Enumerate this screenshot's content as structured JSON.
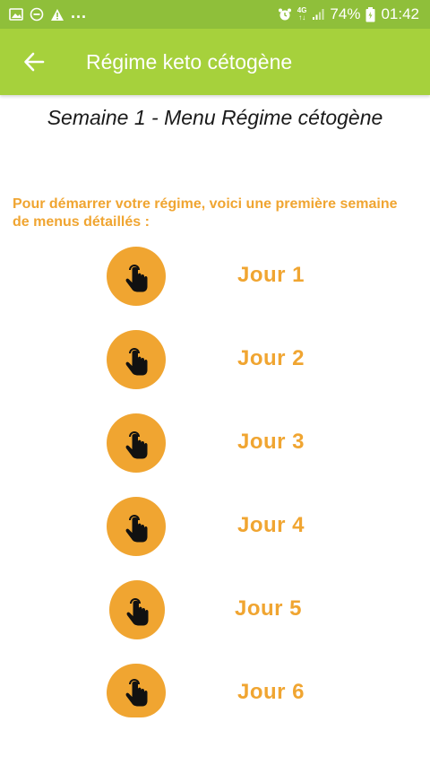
{
  "status_bar": {
    "left_icons": [
      "image-icon",
      "minus-circle-icon",
      "warning-icon"
    ],
    "more": "...",
    "network_top": "4G",
    "network_bottom": "↑↓",
    "battery": "74%",
    "time": "01:42"
  },
  "app_bar": {
    "title": "Régime keto cétogène"
  },
  "page": {
    "subtitle": "Semaine 1 - Menu Régime cétogène",
    "intro": "Pour démarrer votre régime, voici une première semaine de menus détaillés :"
  },
  "days": [
    {
      "label": "Jour 1",
      "icon": "tap-hand-icon"
    },
    {
      "label": "Jour 2",
      "icon": "tap-hand-icon"
    },
    {
      "label": "Jour 3",
      "icon": "tap-hand-icon"
    },
    {
      "label": "Jour 4",
      "icon": "tap-hand-icon"
    },
    {
      "label": "Jour 5",
      "icon": "tap-hand-icon"
    },
    {
      "label": "Jour 6",
      "icon": "tap-hand-icon"
    }
  ],
  "colors": {
    "status_bar": "#8fbf3a",
    "app_bar": "#a6d13c",
    "accent_orange": "#f0a531"
  }
}
